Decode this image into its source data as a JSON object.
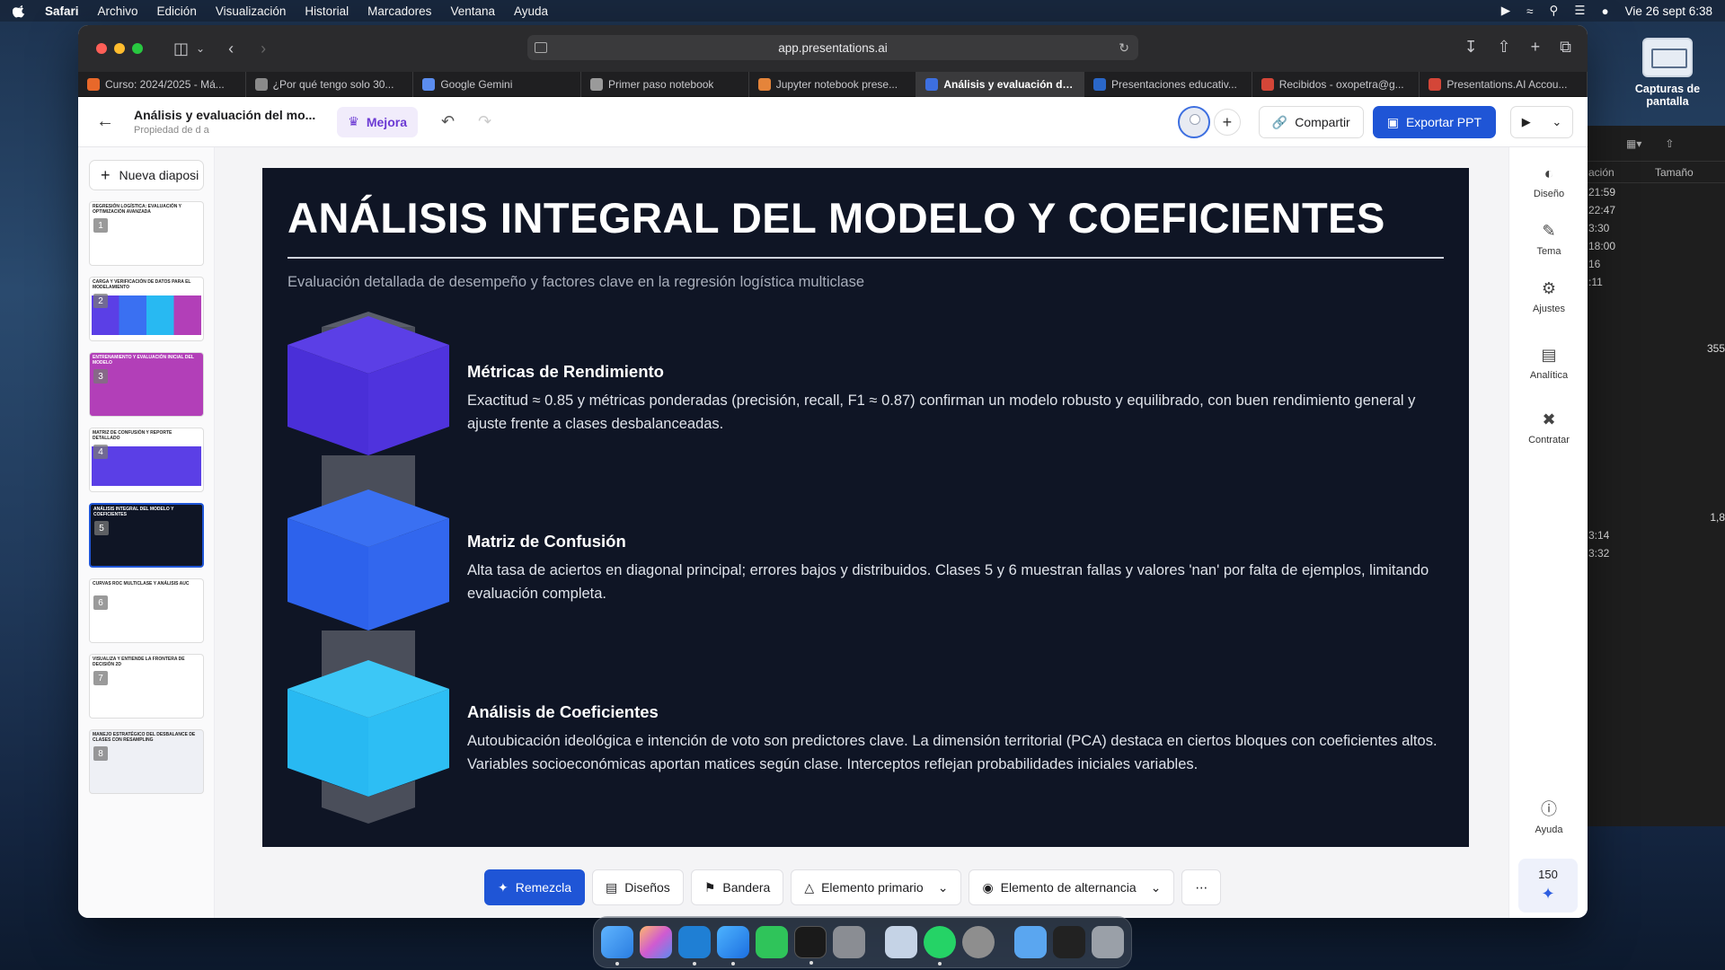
{
  "menubar": {
    "app": "Safari",
    "items": [
      "Archivo",
      "Edición",
      "Visualización",
      "Historial",
      "Marcadores",
      "Ventana",
      "Ayuda"
    ],
    "datetime": "Vie 26 sept 6:38"
  },
  "desktop": {
    "screenshot_label": "Capturas de pantalla"
  },
  "finder": {
    "col_date": "ación",
    "col_size": "Tamaño",
    "rows": [
      "21:59",
      "22:47",
      "3:30",
      "18:00",
      "16",
      ":11"
    ],
    "rows2": [
      "3:14",
      "3:32"
    ],
    "size1": "355",
    "size2": "1,8"
  },
  "browser": {
    "url": "app.presentations.ai",
    "tabs": [
      {
        "title": "Curso: 2024/2025 - Má...",
        "color": "#e8682a"
      },
      {
        "title": "¿Por qué tengo solo 30...",
        "color": "#8a8a8a"
      },
      {
        "title": "Google Gemini",
        "color": "#5b8def"
      },
      {
        "title": "Primer paso notebook",
        "color": "#9a9a9a"
      },
      {
        "title": "Jupyter notebook prese...",
        "color": "#e5843a"
      },
      {
        "title": "Análisis y evaluación del...",
        "color": "#3d6fe0"
      },
      {
        "title": "Presentaciones educativ...",
        "color": "#2a67c9"
      },
      {
        "title": "Recibidos - oxopetra@g...",
        "color": "#d44638"
      },
      {
        "title": "Presentations.AI Accou...",
        "color": "#d44638"
      }
    ]
  },
  "app": {
    "doc_title": "Análisis y evaluación del mo...",
    "doc_owner": "Propiedad de d a",
    "mejora": "Mejora",
    "share": "Compartir",
    "export": "Exportar PPT",
    "new_slide": "Nueva diaposi",
    "slides": [
      {
        "num": "1",
        "title": "REGRESIÓN LOGÍSTICA: EVALUACIÓN Y OPTIMIZACIÓN AVANZADA"
      },
      {
        "num": "2",
        "title": "CARGA Y VERIFICACIÓN DE DATOS PARA EL MODELAMIENTO"
      },
      {
        "num": "3",
        "title": "ENTRENAMIENTO Y EVALUACIÓN INICIAL DEL MODELO"
      },
      {
        "num": "4",
        "title": "MATRIZ DE CONFUSIÓN Y REPORTE DETALLADO"
      },
      {
        "num": "5",
        "title": "ANÁLISIS INTEGRAL DEL MODELO Y COEFICIENTES"
      },
      {
        "num": "6",
        "title": "CURVAS ROC MULTICLASE Y ANÁLISIS AUC"
      },
      {
        "num": "7",
        "title": "VISUALIZA Y ENTIENDE LA FRONTERA DE DECISIÓN 2D"
      },
      {
        "num": "8",
        "title": "MANEJO ESTRATÉGICO DEL DESBALANCE DE CLASES CON RESAMPLING"
      }
    ],
    "bottom": {
      "remix": "Remezcla",
      "designs": "Diseños",
      "flag": "Bandera",
      "primary": "Elemento primario",
      "alternate": "Elemento de alternancia"
    },
    "right_tools": [
      "Diseño",
      "Tema",
      "Ajustes",
      "Analítica",
      "Contratar"
    ],
    "help": "Ayuda",
    "credits": "150"
  },
  "slide": {
    "title": "ANÁLISIS INTEGRAL DEL MODELO Y COEFICIENTES",
    "subtitle": "Evaluación detallada de desempeño y factores clave en la regresión logística multiclase",
    "items": [
      {
        "heading": "Métricas de Rendimiento",
        "body": "Exactitud ≈ 0.85 y métricas ponderadas (precisión, recall, F1 ≈ 0.87) confirman un modelo robusto y equilibrado, con buen rendimiento general y ajuste frente a clases desbalanceadas."
      },
      {
        "heading": "Matriz de Confusión",
        "body": "Alta tasa de aciertos en diagonal principal; errores bajos y distribuidos. Clases 5 y 6 muestran fallas y valores 'nan' por falta de ejemplos, limitando evaluación completa."
      },
      {
        "heading": "Análisis de Coeficientes",
        "body": "Autoubicación ideológica e intención de voto son predictores clave. La dimensión territorial (PCA) destaca en ciertos bloques con coeficientes altos. Variables socioeconómicas aportan matices según clase. Interceptos reflejan probabilidades iniciales variables."
      }
    ],
    "colors": {
      "background": "#0f1525",
      "cube1": "#4a2fd8",
      "cube2": "#2d62ec",
      "cube3": "#28b9f2",
      "connector": "#4a4e5a"
    }
  }
}
